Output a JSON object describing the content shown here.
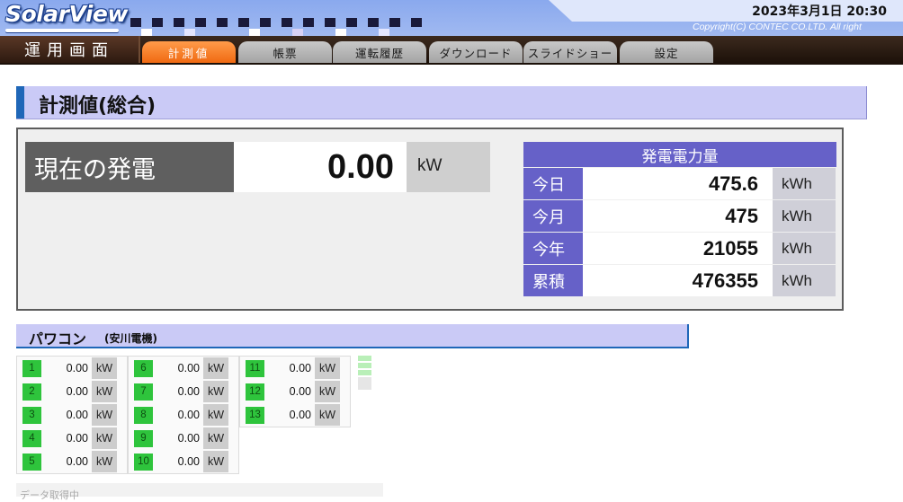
{
  "header": {
    "logo_text": "SolarView",
    "datetime": "2023年3月1日 20:30",
    "copyright": "Copyright(C) CONTEC CO.LTD. All right"
  },
  "nav": {
    "main_label": "運用画面",
    "tabs": [
      {
        "label": "計測値",
        "active": true
      },
      {
        "label": "帳票",
        "active": false
      },
      {
        "label": "運転履歴",
        "active": false
      },
      {
        "label": "ダウンロード",
        "active": false
      },
      {
        "label": "スライドショー",
        "active": false
      },
      {
        "label": "設定",
        "active": false
      }
    ]
  },
  "page": {
    "title": "計測値(総合)"
  },
  "current": {
    "label": "現在の発電",
    "value": "0.00",
    "unit": "kW"
  },
  "energy": {
    "header": "発電電力量",
    "rows": [
      {
        "label": "今日",
        "value": "475.6",
        "unit": "kWh"
      },
      {
        "label": "今月",
        "value": "475",
        "unit": "kWh"
      },
      {
        "label": "今年",
        "value": "21055",
        "unit": "kWh"
      },
      {
        "label": "累積",
        "value": "476355",
        "unit": "kWh"
      }
    ]
  },
  "power_conditioners": {
    "title": "パワコン",
    "maker": "(安川電機)",
    "units": [
      {
        "id": "1",
        "value": "0.00",
        "unit": "kW"
      },
      {
        "id": "2",
        "value": "0.00",
        "unit": "kW"
      },
      {
        "id": "3",
        "value": "0.00",
        "unit": "kW"
      },
      {
        "id": "4",
        "value": "0.00",
        "unit": "kW"
      },
      {
        "id": "5",
        "value": "0.00",
        "unit": "kW"
      },
      {
        "id": "6",
        "value": "0.00",
        "unit": "kW"
      },
      {
        "id": "7",
        "value": "0.00",
        "unit": "kW"
      },
      {
        "id": "8",
        "value": "0.00",
        "unit": "kW"
      },
      {
        "id": "9",
        "value": "0.00",
        "unit": "kW"
      },
      {
        "id": "10",
        "value": "0.00",
        "unit": "kW"
      },
      {
        "id": "11",
        "value": "0.00",
        "unit": "kW"
      },
      {
        "id": "12",
        "value": "0.00",
        "unit": "kW"
      },
      {
        "id": "13",
        "value": "0.00",
        "unit": "kW"
      }
    ]
  },
  "status": {
    "text": "データ取得中"
  },
  "colors": {
    "accent_tab": "#f06a12",
    "purple": "#6661c8",
    "green_badge": "#2ec43c",
    "title_band": "#cacaf6"
  }
}
